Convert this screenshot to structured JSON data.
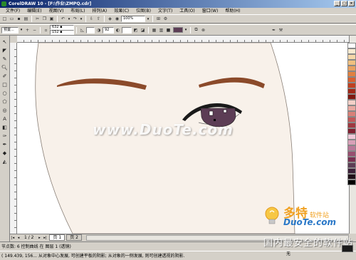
{
  "window": {
    "title": "CorelDRAW 10 - [F:\\作业\\ZMPQ.cdr]",
    "controls": [
      "_",
      "□",
      "×"
    ]
  },
  "menu": [
    "文件(F)",
    "编辑(E)",
    "视图(V)",
    "布局(L)",
    "排列(A)",
    "效果(C)",
    "位图(B)",
    "文字(T)",
    "工具(O)",
    "窗口(W)",
    "帮助(H)"
  ],
  "toolbar1": {
    "zoom_value": "100%"
  },
  "toolbar2": {
    "preset": "预置...",
    "x_value": "632 ▪",
    "y_value": "152 ▪",
    "size_value": "92",
    "fill_color": "#5c3d55"
  },
  "toolbox_icons": [
    "pick-icon",
    "shape-icon",
    "knife-icon",
    "zoom-icon",
    "freehand-icon",
    "rectangle-icon",
    "ellipse-icon",
    "polygon-icon",
    "spiral-icon",
    "text-icon",
    "interactive-icon",
    "eyedropper-icon",
    "outline-icon",
    "fill-icon",
    "interactive-fill-icon"
  ],
  "pagebar": {
    "position": "1 / 2",
    "tabs": [
      "页 1",
      "页 2"
    ]
  },
  "status": {
    "line1": "节点数: 6                                                   控制曲线 在 图层 1 (透镜)",
    "line2": "( 149.439, 156... 从对象中心发展, 可创建平板的阴影; 从对象的一侧发展, 则可创建透视的阴影.",
    "fill_label": "无"
  },
  "watermark": "www.DuoTe.com",
  "brand": {
    "cn": "多特",
    "sub": "软件站",
    "en": "DuoTe.com",
    "tagline": "国内最安全的软件站"
  },
  "palette_colors": [
    "#ffffff",
    "#f8ead0",
    "#f5d7a8",
    "#f0c080",
    "#e8a060",
    "#e08040",
    "#d86030",
    "#c04020",
    "#a02818",
    "#801810",
    "#f4d0c8",
    "#e8a8a0",
    "#d88078",
    "#c05858",
    "#a03840",
    "#802030",
    "#f0c8d8",
    "#d8a0b8",
    "#b87898",
    "#985070",
    "#783050",
    "#5c3d55",
    "#3c2038",
    "#201018",
    "#000000"
  ],
  "drawing": {
    "skin_color": "#f8f1ea",
    "brow_color": "#8b4a2a",
    "iris_color": "#5c3d55"
  }
}
